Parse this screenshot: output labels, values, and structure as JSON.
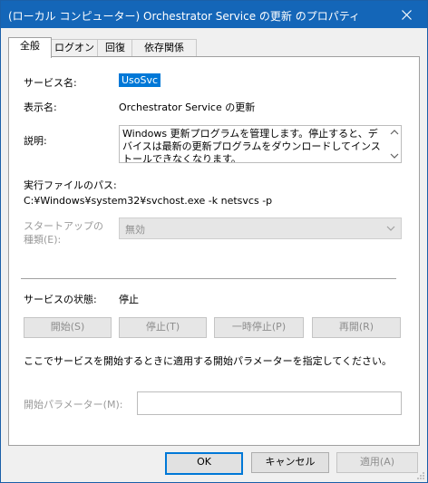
{
  "window": {
    "title": "(ローカル コンピューター) Orchestrator Service の更新 のプロパティ"
  },
  "tabs": [
    "全般",
    "ログオン",
    "回復",
    "依存関係"
  ],
  "general": {
    "service_name_label": "サービス名:",
    "service_name_value": "UsoSvc",
    "display_name_label": "表示名:",
    "display_name_value": "Orchestrator Service の更新",
    "description_label": "説明:",
    "description_value": "Windows 更新プログラムを管理します。停止すると、デバイスは最新の更新プログラムをダウンロードしてインストールできなくなります。",
    "exe_path_label": "実行ファイルのパス:",
    "exe_path_value": "C:¥Windows¥system32¥svchost.exe -k netsvcs -p",
    "startup_type_label_line1": "スタートアップの",
    "startup_type_label_line2": "種類(E):",
    "startup_type_value": "無効",
    "status_label": "サービスの状態:",
    "status_value": "停止",
    "buttons": {
      "start": "開始(S)",
      "stop": "停止(T)",
      "pause": "一時停止(P)",
      "resume": "再開(R)"
    },
    "hint": "ここでサービスを開始するときに適用する開始パラメーターを指定してください。",
    "params_label": "開始パラメーター(M):",
    "params_value": ""
  },
  "footer": {
    "ok": "OK",
    "cancel": "キャンセル",
    "apply": "適用(A)"
  },
  "icons": {
    "close": "close-icon",
    "combo": "chevron-down-icon",
    "scroll_up": "scroll-up-icon",
    "scroll_down": "scroll-down-icon"
  },
  "colors": {
    "titlebar": "#1466b8",
    "selection": "#0078d7",
    "disabled_text": "#8e8e8e"
  }
}
